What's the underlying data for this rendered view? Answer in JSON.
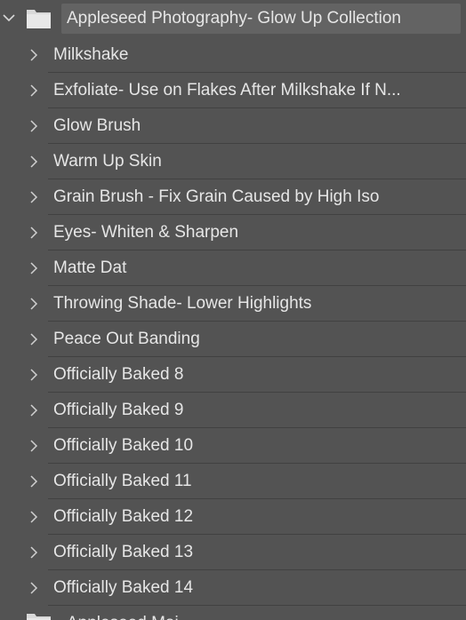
{
  "group": {
    "name": "Appleseed Photography-  Glow Up Collection",
    "expanded": true,
    "chevron_icon": "chevron-down-icon",
    "folder_icon": "folder-icon"
  },
  "items": [
    {
      "label": "Milkshake"
    },
    {
      "label": "Exfoliate- Use on Flakes After Milkshake If N..."
    },
    {
      "label": "Glow Brush"
    },
    {
      "label": "Warm Up Skin"
    },
    {
      "label": "Grain Brush - Fix Grain Caused by High Iso"
    },
    {
      "label": "Eyes- Whiten & Sharpen"
    },
    {
      "label": "Matte Dat"
    },
    {
      "label": "Throwing Shade- Lower Highlights"
    },
    {
      "label": "Peace Out Banding"
    },
    {
      "label": "Officially Baked 8"
    },
    {
      "label": "Officially Baked 9"
    },
    {
      "label": "Officially Baked 10"
    },
    {
      "label": "Officially Baked 11"
    },
    {
      "label": "Officially Baked 12"
    },
    {
      "label": "Officially Baked 13"
    },
    {
      "label": "Officially Baked 14"
    }
  ],
  "next_group": {
    "name": "Appleseed Mai..."
  },
  "colors": {
    "background": "#535353",
    "selected_name_bg": "#636363",
    "text": "#e6e6e6",
    "divider": "#414141"
  }
}
